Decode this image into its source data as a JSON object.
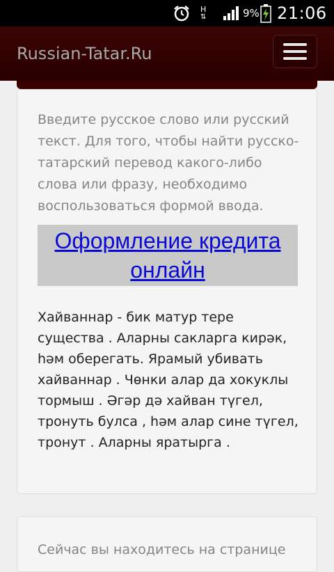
{
  "status_bar": {
    "h_label": "H",
    "battery_percent": "9%",
    "time": "21:06",
    "icons": [
      "alarm-clock-icon",
      "network-h-icon",
      "signal-icon",
      "battery-charging-icon"
    ]
  },
  "navbar": {
    "brand": "Russian-Tatar.Ru",
    "menu_icon": "hamburger-icon",
    "bg_color": "#2a0000"
  },
  "panel1": {
    "intro": "Введите русское слово или русский текст. Для того, чтобы найти русско-татарский перевод какого-либо слова или фразу, необходимо воспользоваться формой ввода.",
    "ad_link": "Оформление кредита онлайн",
    "ad_link_color": "#0a0ad6",
    "body": "Хайваннар - бик матур тере существа . Аларны сакларга кирәк, һәм оберегать. Ярамый убивать хайваннар . Чөнки алар да хокуклы тормыш . Әгәр дә хайван түгел, тронуть булса , һәм алар сине түгел, тронут . Аларны яратырга ."
  },
  "panel2": {
    "text": "Сейчас вы находитесь на странице"
  }
}
